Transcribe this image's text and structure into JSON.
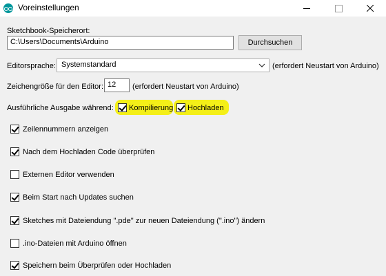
{
  "window": {
    "title": "Voreinstellungen",
    "controls": [
      "minimize-icon",
      "maximize-icon",
      "close-icon"
    ]
  },
  "sketchbook": {
    "label": "Sketchbook-Speicherort:",
    "path": "C:\\Users\\Documents\\Arduino",
    "browse_label": "Durchsuchen"
  },
  "editor_language": {
    "label": "Editorsprache:",
    "selected": "Systemstandard",
    "note": "(erfordert Neustart von Arduino)"
  },
  "font_size": {
    "label": "Zeichengröße für den Editor:",
    "value": "12",
    "note": "(erfordert Neustart von Arduino)"
  },
  "verbose": {
    "label": "Ausführliche Ausgabe während:",
    "compile": {
      "label": "Kompilierung",
      "checked": true
    },
    "upload": {
      "label": "Hochladen",
      "checked": true
    },
    "highlight_color": "#f4ef18"
  },
  "options": [
    {
      "label": "Zeilennummern anzeigen",
      "checked": true
    },
    {
      "label": "Nach dem Hochladen Code überprüfen",
      "checked": true
    },
    {
      "label": "Externen Editor verwenden",
      "checked": false
    },
    {
      "label": "Beim Start nach Updates suchen",
      "checked": true
    },
    {
      "label": "Sketches mit Dateiendung \".pde\" zur neuen Dateiendung (\".ino\") ändern",
      "checked": true
    },
    {
      "label": ".ino-Dateien mit Arduino öffnen",
      "checked": false
    },
    {
      "label": "Speichern beim Überprüfen oder Hochladen",
      "checked": true
    }
  ],
  "colors": {
    "dialog_bg": "#f0f0f0",
    "titlebar_bg": "#ffffff",
    "app_icon": "#00979c"
  }
}
